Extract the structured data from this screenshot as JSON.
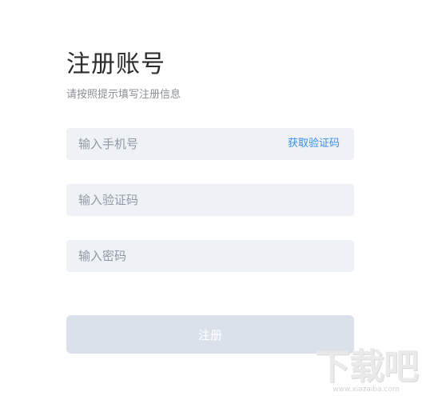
{
  "header": {
    "title": "注册账号",
    "subtitle": "请按照提示填写注册信息"
  },
  "form": {
    "phone": {
      "placeholder": "输入手机号",
      "value": "",
      "get_code_label": "获取验证码"
    },
    "code": {
      "placeholder": "输入验证码",
      "value": ""
    },
    "password": {
      "placeholder": "输入密码",
      "value": ""
    },
    "submit_label": "注册"
  },
  "watermark": {
    "logo": "下载吧",
    "url": "www.xiazaiba.com"
  },
  "colors": {
    "title_text": "#2b2b2b",
    "subtitle_text": "#8a8f96",
    "field_background": "#eef2f6",
    "placeholder_text": "#9098a1",
    "link_accent": "#3a8ee6",
    "submit_disabled_background": "#dbe1ea",
    "submit_text": "#ffffff"
  }
}
